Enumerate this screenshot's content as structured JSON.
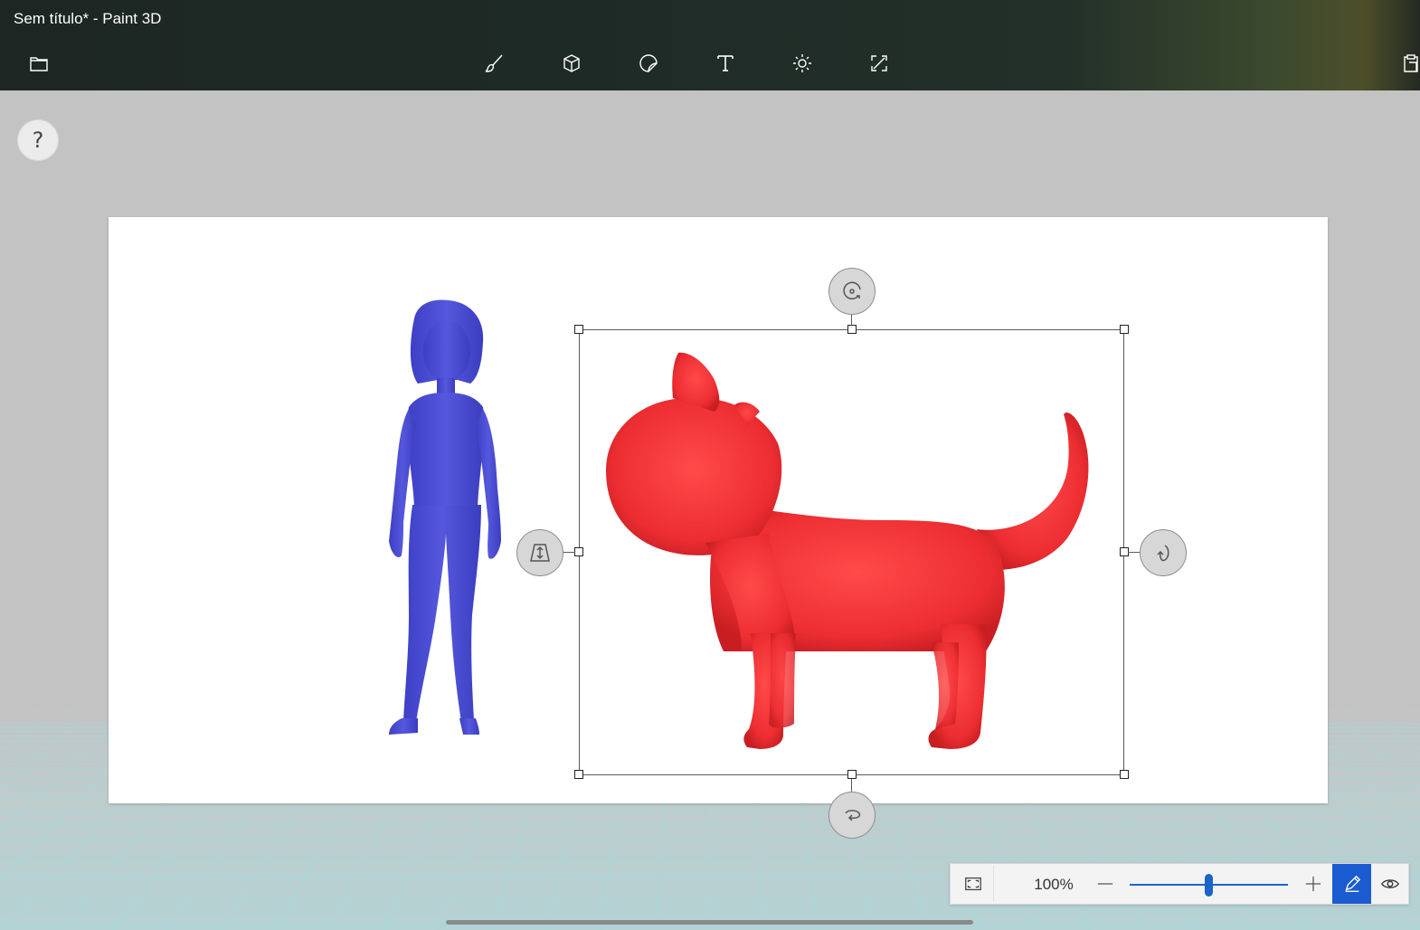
{
  "window": {
    "title": "Sem título* - Paint 3D"
  },
  "toolbar": {
    "items": [
      {
        "name": "menu-icon"
      },
      {
        "name": "brushes-icon"
      },
      {
        "name": "3d-shapes-icon"
      },
      {
        "name": "stickers-icon"
      },
      {
        "name": "text-icon"
      },
      {
        "name": "effects-icon"
      },
      {
        "name": "canvas-icon"
      },
      {
        "name": "paste-icon"
      }
    ]
  },
  "help": {
    "label": "?"
  },
  "scene": {
    "objects": [
      {
        "name": "woman-figure",
        "color": "#4f52d6"
      },
      {
        "name": "cat-figure",
        "color": "#ec2e32",
        "selected": true
      }
    ]
  },
  "zoom": {
    "value_label": "100%",
    "value": 100,
    "slider_fraction": 0.5,
    "accent": "#1a64c8",
    "edit_mode_active": true
  }
}
